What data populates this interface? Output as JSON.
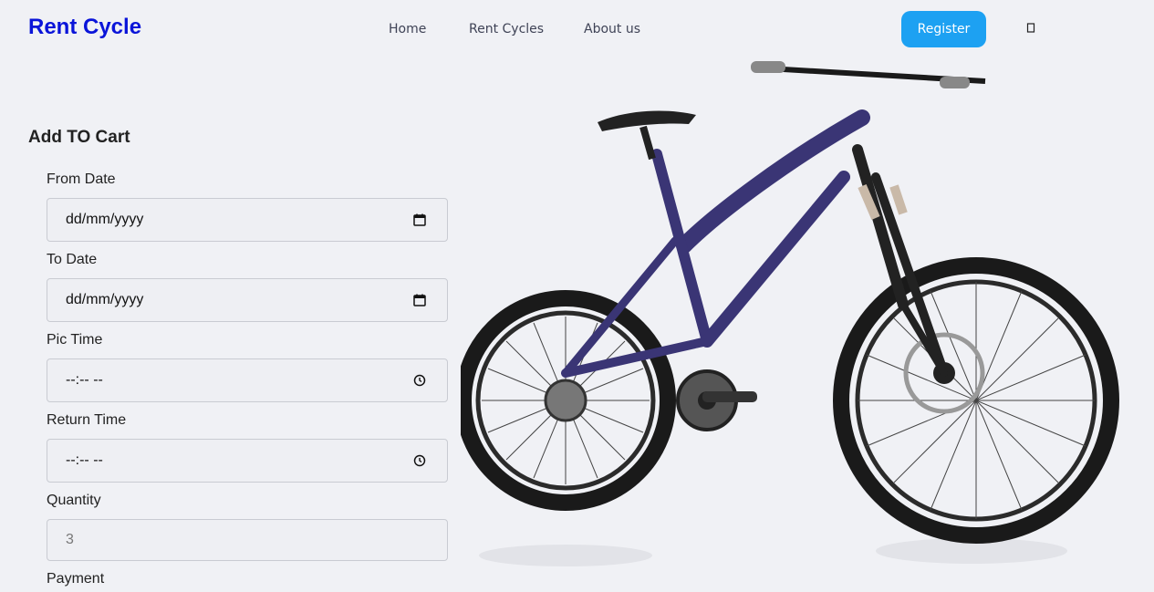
{
  "header": {
    "brand": "Rent Cycle",
    "nav": [
      "Home",
      "Rent Cycles",
      "About us"
    ],
    "register_label": "Register"
  },
  "form": {
    "title": "Add TO Cart",
    "from_date_label": "From Date",
    "from_date_value": "dd/mm/yyyy",
    "to_date_label": "To Date",
    "to_date_value": "dd/mm/yyyy",
    "pic_time_label": "Pic Time",
    "pic_time_value": "--:-- --",
    "return_time_label": "Return Time",
    "return_time_value": "--:-- --",
    "quantity_label": "Quantity",
    "quantity_value": "3",
    "payment_label": "Payment"
  },
  "colors": {
    "brand": "#0a14d9",
    "register": "#1da1f2",
    "background": "#f0f1f5",
    "bike_frame": "#3a3575"
  },
  "icons": {
    "date": "calendar-icon",
    "time": "clock-icon",
    "cart": "cart-icon"
  }
}
